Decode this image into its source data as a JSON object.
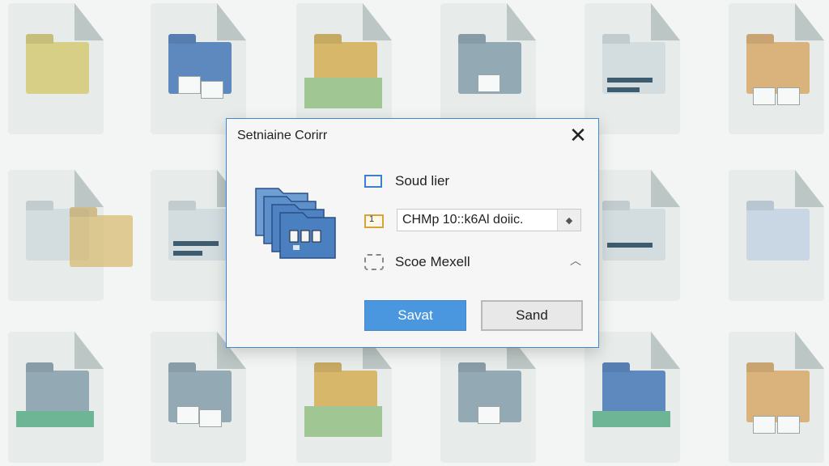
{
  "dialog": {
    "title": "Setniaine Corirr",
    "close_label": "✕",
    "option1_label": "Soud lier",
    "path_value": "CHMp 10::k6Al doiic.",
    "folder_badge": "1",
    "option3_label": "Scoe Mexell",
    "primary_button": "Savat",
    "secondary_button": "Sand"
  },
  "icons": {
    "dialog_close": "close-icon",
    "hero": "folder-stack-icon",
    "option1": "checkbox-icon",
    "option2": "folder-icon",
    "option3": "dashed-box-icon",
    "path_spinner": "spinner-icon",
    "collapse": "chevron-up-icon"
  },
  "colors": {
    "dialog_border": "#3f88d6",
    "primary_button": "#4a97df",
    "checkbox_border": "#3a7fd4"
  }
}
